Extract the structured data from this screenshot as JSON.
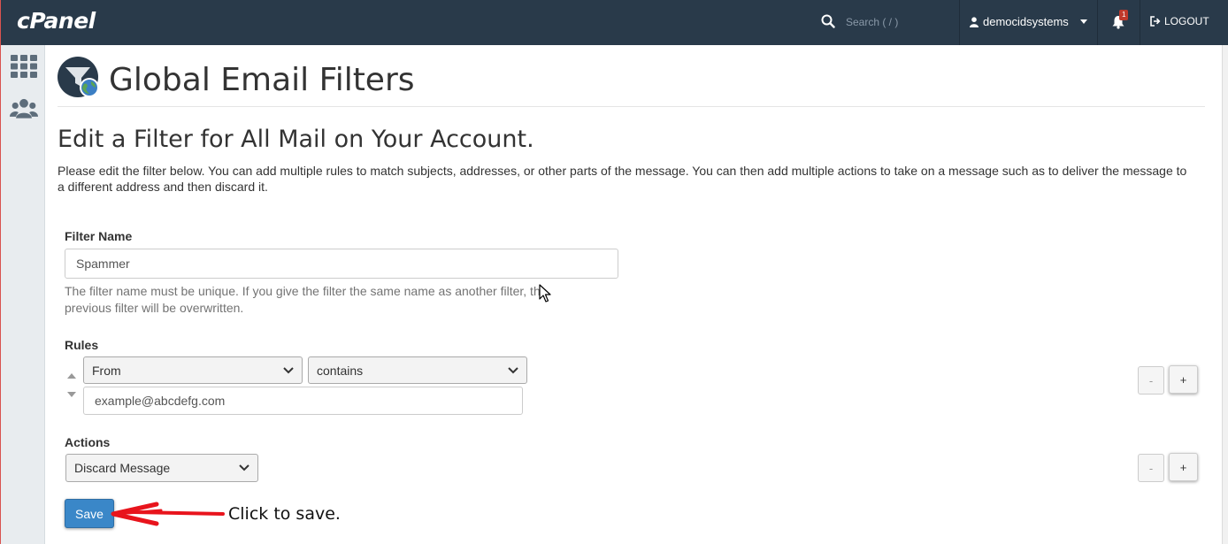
{
  "header": {
    "logo_text": "cPanel",
    "search_placeholder": "Search ( / )",
    "username": "democidsystems",
    "notification_count": "1",
    "logout_label": "LOGOUT"
  },
  "page": {
    "title": "Global Email Filters",
    "subtitle": "Edit a Filter for All Mail on Your Account.",
    "description": "Please edit the filter below. You can add multiple rules to match subjects, addresses, or other parts of the message. You can then add multiple actions to take on a message such as to deliver the message to a different address and then discard it."
  },
  "form": {
    "filter_name_label": "Filter Name",
    "filter_name_value": "Spammer",
    "filter_name_help": "The filter name must be unique. If you give the filter the same name as another filter, the previous filter will be overwritten.",
    "rules_label": "Rules",
    "rule_part": "From",
    "rule_match": "contains",
    "rule_value": "example@abcdefg.com",
    "actions_label": "Actions",
    "action_value": "Discard Message",
    "remove_label": "-",
    "add_label": "+",
    "save_label": "Save"
  },
  "annotation": {
    "text": "Click to save.",
    "color": "#e8141c"
  },
  "colors": {
    "topbar": "#293a4a",
    "primary_button": "#3a87c8",
    "sidebar": "#e8ecef"
  }
}
